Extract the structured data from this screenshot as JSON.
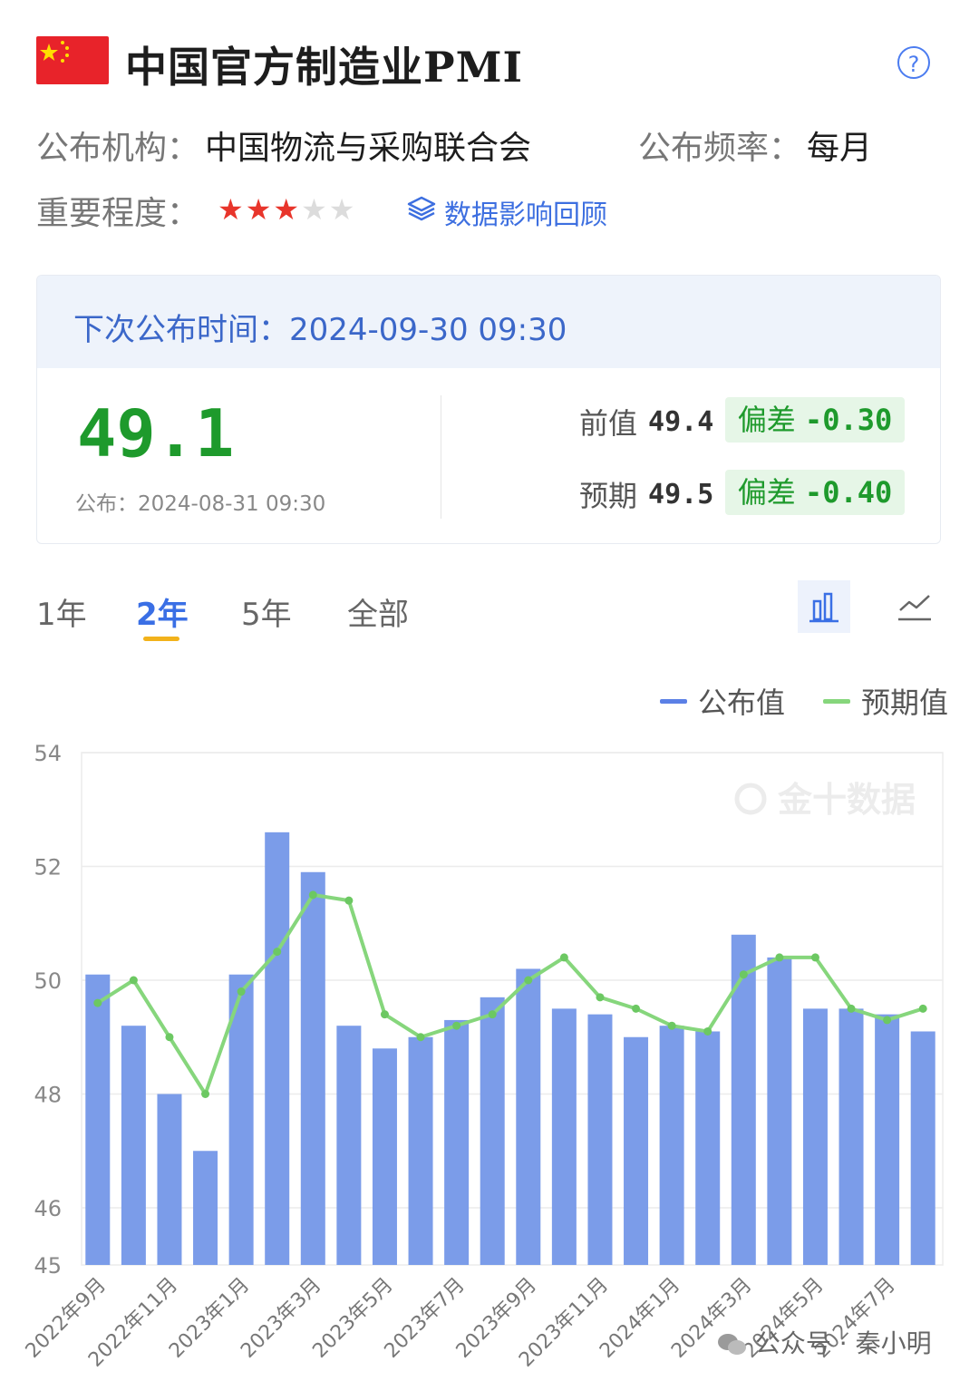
{
  "header": {
    "title": "中国官方制造业PMI",
    "help_icon": "?",
    "publisher_label": "公布机构：",
    "publisher": "中国物流与采购联合会",
    "frequency_label": "公布频率：",
    "frequency": "每月",
    "importance_label": "重要程度：",
    "importance_stars": 3,
    "importance_max": 5,
    "review_link": "数据影响回顾"
  },
  "release": {
    "next_label": "下次公布时间：",
    "next_time": "2024-09-30 09:30",
    "actual": "49.1",
    "published_label": "公布：",
    "published_time": "2024-08-31 09:30",
    "previous_label": "前值",
    "previous": "49.4",
    "forecast_label": "预期",
    "forecast": "49.5",
    "deviation_label": "偏差",
    "deviation_previous": "-0.30",
    "deviation_forecast": "-0.40"
  },
  "tabs": [
    {
      "label": "1年",
      "active": false
    },
    {
      "label": "2年",
      "active": true
    },
    {
      "label": "5年",
      "active": false
    },
    {
      "label": "全部",
      "active": false
    }
  ],
  "view_buttons": [
    {
      "icon": "bar-chart-icon",
      "active": true
    },
    {
      "icon": "line-chart-icon",
      "active": false
    }
  ],
  "chart_data": {
    "type": "bar",
    "watermark": "金十数据",
    "categories": [
      "2022年9月",
      "2022年10月",
      "2022年11月",
      "2022年12月",
      "2023年1月",
      "2023年2月",
      "2023年3月",
      "2023年4月",
      "2023年5月",
      "2023年6月",
      "2023年7月",
      "2023年8月",
      "2023年9月",
      "2023年10月",
      "2023年11月",
      "2023年12月",
      "2024年1月",
      "2024年2月",
      "2024年3月",
      "2024年4月",
      "2024年5月",
      "2024年6月",
      "2024年7月",
      "2024年8月"
    ],
    "x_tick_labels": [
      "2022年9月",
      "2022年11月",
      "2023年1月",
      "2023年3月",
      "2023年5月",
      "2023年7月",
      "2023年9月",
      "2023年11月",
      "2024年1月",
      "2024年3月",
      "2024年5月",
      "2024年7月"
    ],
    "y_ticks": [
      54,
      52,
      50,
      48,
      46,
      45
    ],
    "ylim": [
      45,
      54
    ],
    "grid": true,
    "legend_position": "top-right",
    "series": [
      {
        "name": "公布值",
        "type": "bar",
        "color": "#7b9ce9",
        "values": [
          50.1,
          49.2,
          48.0,
          47.0,
          50.1,
          52.6,
          51.9,
          49.2,
          48.8,
          49.0,
          49.3,
          49.7,
          50.2,
          49.5,
          49.4,
          49.0,
          49.2,
          49.1,
          50.8,
          50.4,
          49.5,
          49.5,
          49.4,
          49.1
        ]
      },
      {
        "name": "预期值",
        "type": "line",
        "color": "#86d67c",
        "values": [
          49.6,
          50.0,
          49.0,
          48.0,
          49.8,
          50.5,
          51.5,
          51.4,
          49.4,
          49.0,
          49.2,
          49.4,
          50.0,
          50.4,
          49.7,
          49.5,
          49.2,
          49.1,
          50.1,
          50.4,
          50.4,
          49.5,
          49.3,
          49.5
        ]
      }
    ]
  },
  "footer_watermark": "公众号 · 秦小明",
  "colors": {
    "accent_blue": "#3a6fe5",
    "positive_green": "#1e9a2c",
    "star_red": "#e8352b",
    "tab_underline": "#f2b21b"
  }
}
